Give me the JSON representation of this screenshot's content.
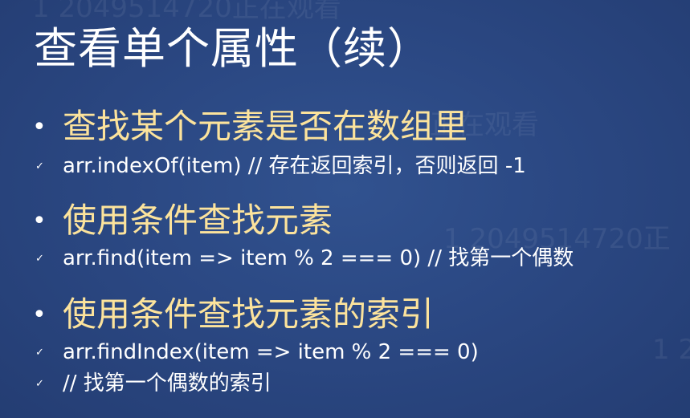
{
  "watermark": {
    "text_1": "1 2049514720正在观看",
    "text_2": "正在观看",
    "text_3": "1 2049514720正",
    "text_4": "1 2"
  },
  "slide": {
    "title": "查看单个属性（续）",
    "bullets": [
      {
        "marker": "•",
        "text": "查找某个元素是否在数组里",
        "subs": [
          {
            "marker": "✓",
            "text": "arr.indexOf(item) // 存在返回索引，否则返回 -1"
          }
        ]
      },
      {
        "marker": "•",
        "text": "使用条件查找元素",
        "subs": [
          {
            "marker": "✓",
            "text": "arr.find(item => item % 2 === 0) // 找第一个偶数"
          }
        ]
      },
      {
        "marker": "•",
        "text": "使用条件查找元素的索引",
        "subs": [
          {
            "marker": "✓",
            "text": "arr.findIndex(item => item % 2 === 0)"
          },
          {
            "marker": "✓",
            "text": "// 找第一个偶数的索引"
          }
        ]
      }
    ]
  },
  "colors": {
    "background": "#2b4883",
    "title": "#ffffff",
    "bullet_text": "#fce39c",
    "sub_text": "#ffffff"
  }
}
